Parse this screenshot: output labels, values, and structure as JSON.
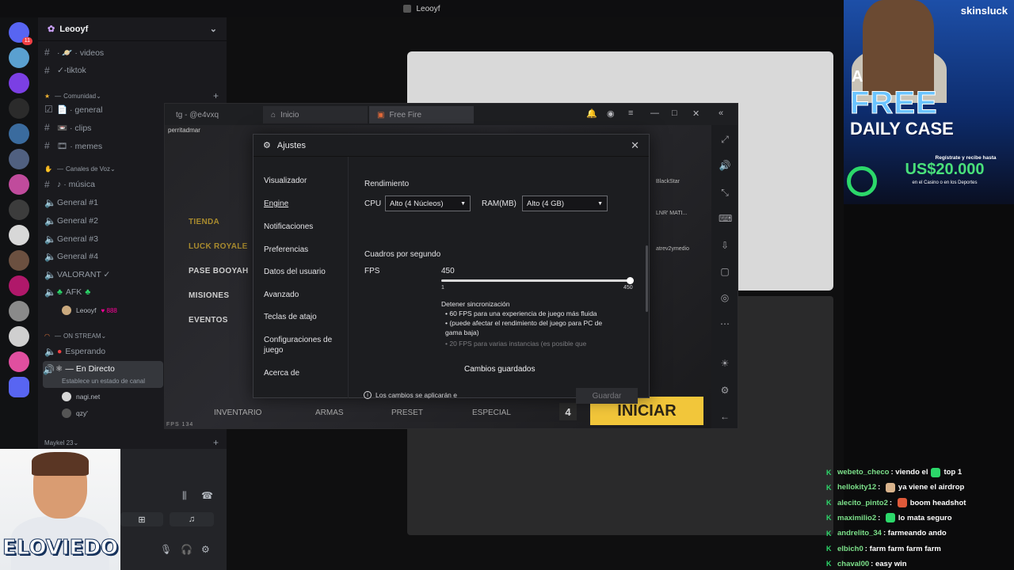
{
  "window_title": "Leooyf",
  "discord": {
    "server_badge": "11",
    "guild_name": "Leooyf",
    "channels_top": [
      {
        "label": "· 🪐 · videos"
      },
      {
        "label": "✓-tiktok"
      }
    ],
    "category_community": "Comunidad",
    "channels_community": [
      {
        "label": "📄 · general"
      },
      {
        "label": "📼 · clips"
      },
      {
        "label": "🎞 · memes"
      }
    ],
    "category_voice": "Canales de Voz",
    "channel_music": "· música",
    "voice_channels": [
      "General #1",
      "General #2",
      "General #3",
      "General #4",
      "VALORANT ✓"
    ],
    "afk_channel": "AFK",
    "afk_user": "Leooyf",
    "afk_user_badge": "888",
    "category_stream": "ON STREAM",
    "stream_waiting": "Esperando",
    "stream_live": "— En Directo",
    "stream_status_hint": "Establece un estado de canal",
    "live_users": [
      "nagi.net",
      "qzy'"
    ],
    "category_maykel": "Maykel 23",
    "cam_brand": "ELOVIEDO"
  },
  "emulator": {
    "tab_user": "tg - @e4vxq",
    "tab_inicio": "Inicio",
    "tab_game": "Free Fire",
    "profile_name": "perritadmar",
    "game_menu": [
      "TIENDA",
      "LUCK ROYALE",
      "PASE BOOYAH",
      "MISIONES",
      "EVENTOS"
    ],
    "game_bottom": [
      "INVENTARIO",
      "ARMAS",
      "PRESET",
      "ESPECIAL"
    ],
    "fps_counter": "FPS 134",
    "start_button": "INICIAR",
    "friends": [
      "BlackStar",
      "LNR' MATI...",
      "atrev2ymedio"
    ],
    "slot_number": "4"
  },
  "settings": {
    "title": "Ajustes",
    "nav": [
      "Visualizador",
      "Engine",
      "Notificaciones",
      "Preferencias",
      "Datos del usuario",
      "Avanzado",
      "Teclas de atajo",
      "Configuraciones de juego",
      "Acerca de"
    ],
    "active_nav": "Engine",
    "section_performance": "Rendimiento",
    "cpu_label": "CPU",
    "cpu_value": "Alto (4 Núcleos)",
    "ram_label": "RAM(MB)",
    "ram_value": "Alto (4 GB)",
    "section_fps": "Cuadros por segundo",
    "fps_label": "FPS",
    "fps_value": "450",
    "fps_min": "1",
    "fps_max": "450",
    "fps_fraction": 1.0,
    "sync_title": "Detener sincronización",
    "bullet_1": "60 FPS para una experiencia de juego más fluida",
    "bullet_2": "(puede afectar el rendimiento del juego para PC de gama baja)",
    "bullet_3": "20 FPS para varias instancias (es posible que",
    "footer_note": "Los cambios se aplicarán e",
    "toast": "Cambios guardados",
    "save_button": "Guardar"
  },
  "ad": {
    "brand": "skinsluck",
    "line_a": "A",
    "line_free": "FREE",
    "line_daily": "DAILY CASE",
    "register": "Regístrate y recibe hasta",
    "money": "US$20.000",
    "casino": "en el Casino o en los Deportes"
  },
  "chat": [
    {
      "user": "webeto_checo",
      "text": "viendo el",
      "tail": "top 1",
      "emote_color": "#2cd86a"
    },
    {
      "user": "hellokity12",
      "text": "ya viene el airdrop",
      "tail": "",
      "emote_color": "#d9b38c"
    },
    {
      "user": "alecito_pinto2",
      "text": "boom headshot",
      "tail": "",
      "emote_color": "#e05a3a"
    },
    {
      "user": "maximilio2",
      "text": "lo mata seguro",
      "tail": "",
      "emote_color": "#2cd86a"
    },
    {
      "user": "andrelito_34",
      "text": "farmeando ando",
      "tail": "",
      "emote_color": ""
    },
    {
      "user": "elbich0",
      "text": "farm farm farm farm",
      "tail": "",
      "emote_color": ""
    },
    {
      "user": "chaval00",
      "text": "easy win",
      "tail": "",
      "emote_color": ""
    }
  ]
}
